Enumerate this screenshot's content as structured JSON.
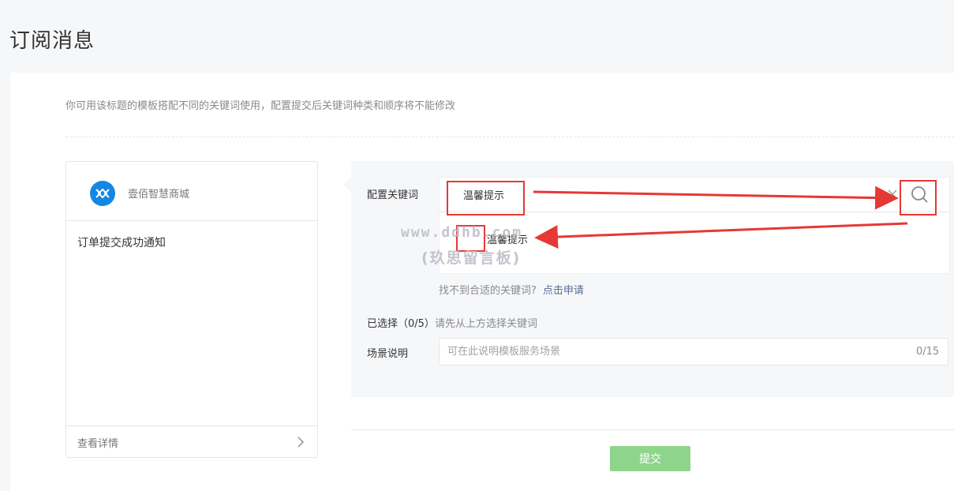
{
  "page": {
    "title": "订阅消息"
  },
  "tip": "你可用该标题的模板搭配不同的关键词使用，配置提交后关键词种类和顺序将不能修改",
  "preview": {
    "shop_name": "壹佰智慧商城",
    "message_title": "订单提交成功通知",
    "detail_link": "查看详情"
  },
  "keyword_config": {
    "label": "配置关键词",
    "input_value": "温馨提示",
    "suggestion": "温馨提示",
    "not_found_text": "找不到合适的关键词?",
    "apply_link": "点击申请"
  },
  "selected": {
    "label": "已选择（0/5）",
    "hint": "请先从上方选择关键词"
  },
  "scene": {
    "label": "场景说明",
    "placeholder": "可在此说明模板服务场景",
    "counter": "0/15"
  },
  "submit_label": "提交",
  "watermark": {
    "line1": "www.ddhb.com",
    "line2": "(玖思留言板)"
  },
  "colors": {
    "accent_link": "#576b95",
    "logo_blue": "#1487e3",
    "submit_disabled_green": "#8fd48b",
    "annotation_red": "#e53935"
  }
}
